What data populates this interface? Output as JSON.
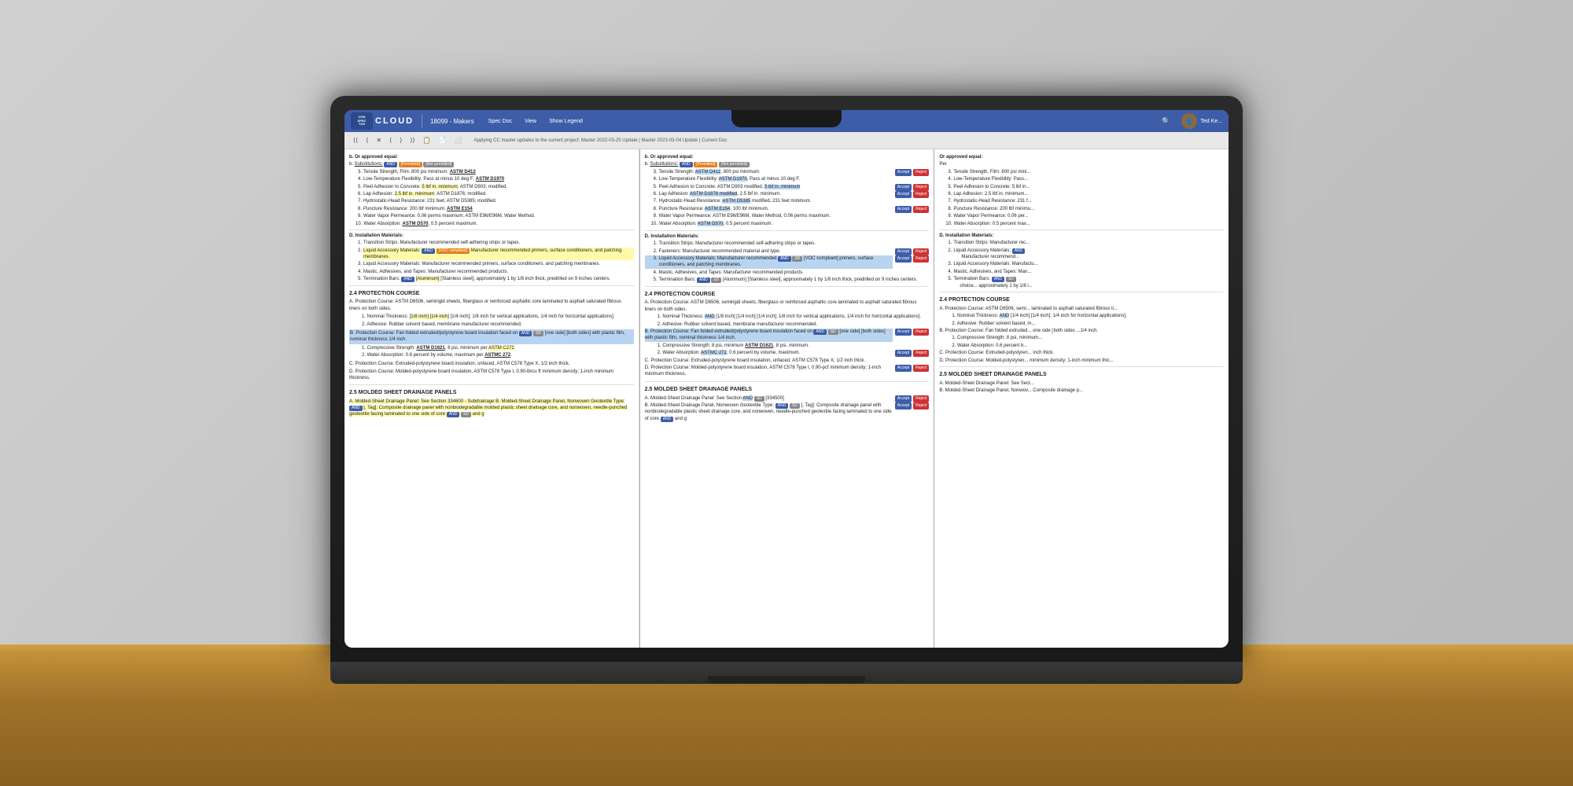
{
  "app": {
    "logo_lines": [
      "CON",
      "SPEC",
      "TUS"
    ],
    "brand": "CLOUD",
    "project_id": "18099 - Makers",
    "nav_items": [
      "Spec Doc",
      "View",
      "Show Legend"
    ],
    "status_bar": "Applying CC master updates to the current project: Master 2022-03-25 Update | Master 2023-03-04 Update | Current Doc",
    "search_icon": "🔍",
    "user_name": "Ted Ke..."
  },
  "toolbar": {
    "buttons": [
      "⟨⟨",
      "⟨",
      "✕",
      "⟨",
      "⟩",
      "⟩⟩",
      "📋",
      "📄",
      "⬜"
    ]
  },
  "left_col": {
    "header": "b. Or approved equal:",
    "substitutions_label": "b. Substitutions:",
    "tags": [
      "AND",
      "[Permitted]",
      "[Not permitted]"
    ],
    "items": [
      "3. Tensile Strength, Film: 800 psi minimum; ASTM D412",
      "4. Low-Temperature Flexibility: Pass at minus 10 deg F; ASTM D1970",
      "5. Peel Adhesion to Concrete: 5 lbf in. minimum; ASTM D903; modified.",
      "6. Lap Adhesion: 2.5 lbf in. minimum; ASTM D1876; modified.",
      "7. Hydrostatic-Head Resistance: 231 feet; ASTM D5385; modified.",
      "8. Puncture Resistance: 200 lbf minimum; ASTM E154",
      "9. Water Vapor Permeance: 0.06 perms maximum; ASTM E96/E96M, Water Method.",
      "10. Water Absorption: 0.5 percent maximum; ASTM D570"
    ],
    "section_d": {
      "header": "D. Installation Materials:",
      "items": [
        "1. Transition Strips: Manufacturer recommended self-adhering strips or tapes.",
        "2. Liquid Accessory Materials:",
        "3. Liquid Accessory Materials: Manufacturer recommended primers, surface conditioners, and patching membranes.",
        "4. Mastic, Adhesives, and Tapes: Manufacturer recommended products.",
        "5. Termination Bars:"
      ]
    },
    "section_2_4": {
      "header": "2.4 PROTECTION COURSE",
      "items_a": "A. Protection Course: ASTM D6506, semirigid sheets, fiberglass or reinforced asphaltic core laminated to asphalt saturated fibrous liners on both sides.",
      "items_b": "B. Protection Course: Fan folded extruded/polystyrene board insulation faced on [one side] [both sides] with plastic film, nominal thickness 1/4 inch.",
      "items_c": "C. Protection Course: Extruded-polystyrene board insulation, unfaced, ASTM C578 Type X, 1/2 inch thick.",
      "items_d": "D. Protection Course: Molded-polystyrene board insulation, ASTM C578 Type I, 0.90-lb/cu ft minimum density; 1-inch minimum thickness."
    },
    "section_2_5": {
      "header": "2.5 MOLDED SHEET DRAINAGE PANELS",
      "items_a": "A. Molded-Sheet Drainage Panel: See Section 334600 - Subdrainage",
      "items_b": "B. Molded-Sheet Drainage Panel, Nonwoven Geotextile Type: Composite drainage panel with nonbiodegradable molded plastic sheet drainage core, and nonwoven, needle-punched geotextile facing laminated to one side of core and g"
    }
  },
  "middle_col": {
    "header": "b. Or approved equal:",
    "substitutions_label": "b. Substitutions:",
    "tags_and": "AND",
    "tags_permitted": "[Permitted]",
    "tags_not_permitted": "[Not permitted]",
    "items": [
      "3. Tensile Strength: ASTM D412, 800 psi minimum.",
      "4. Low-Temperature Flexibility: ASTM D1970, Pass at minus 10 deg F.",
      "5. Peel Adhesion to Concrete: ASTM D903 modified, 5 lbf in. minimum",
      "6. Lap Adhesion: ASTM D1876 modified, 2.5 lbf in. minimum.",
      "7. Hydrostatic-Head Resistance: ASTM D5385 modified, 231 feet minimum.",
      "8. Puncture Resistance: ASTM E154, 100 lbf minimum.",
      "9. Water Vapor Permeance: ASTM E96/E96M, Water Method, 0.06 perms maximum.",
      "10. Water Absorption: ASTM D570, 0.5 percent maximum."
    ]
  },
  "right_col": {
    "header": "Or approved equal:",
    "title2": "Per",
    "items": [
      "3. Tensile Strength, Film: 800 psi mini...",
      "4. Low-Temperature Flexibility: Pass...",
      "5. Peel Adhesion to Concrete: 5 lbf in...",
      "6. Lap Adhesion: 2.5 lbf in. minimum...",
      "7. Hydrostatic-Head Resistance: 231 f...",
      "8. Puncture Resistance: 200 lbf minimu...",
      "9. Water Vapor Permeance: 0.06 per...",
      "10. Water Absorption: 0.5 percent max..."
    ],
    "section_2_4": "2.5 MOLDED SHEET DRAINAGE PANELS"
  },
  "colors": {
    "nav_bg": "#3d5da8",
    "highlight_yellow": "#fffaaa",
    "highlight_blue": "#b8d4f0",
    "tag_blue": "#3d5da8",
    "accept_btn": "#3d5da8",
    "reject_btn": "#cc3333"
  }
}
